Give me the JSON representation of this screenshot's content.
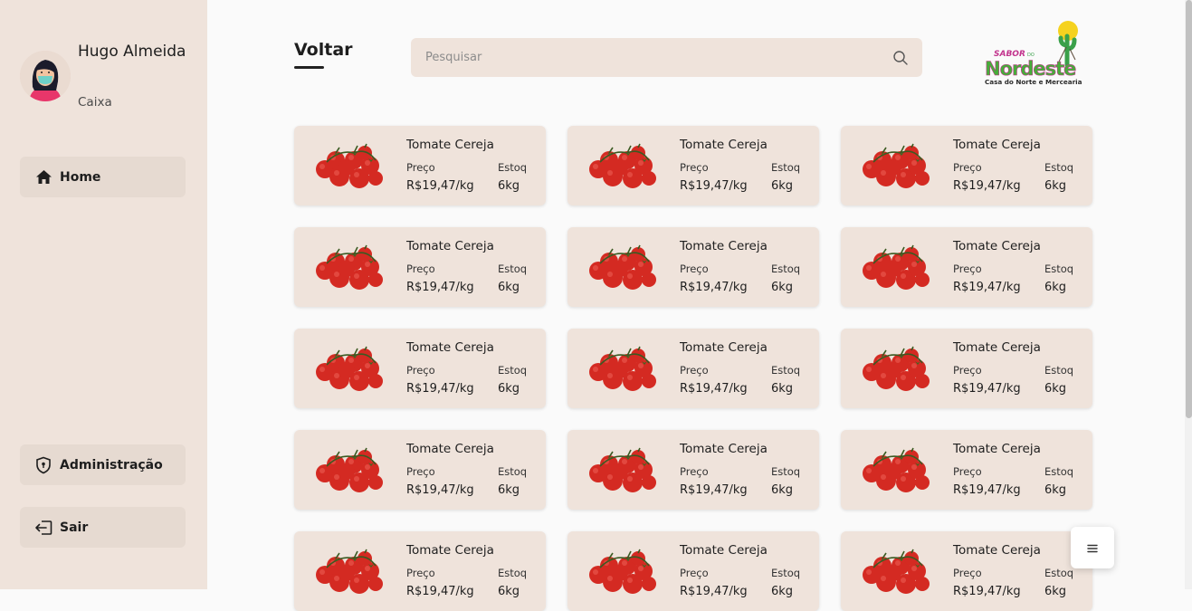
{
  "user": {
    "name": "Hugo Almeida",
    "role": "Caixa"
  },
  "nav": {
    "home": "Home",
    "admin": "Administração",
    "logout": "Sair"
  },
  "header": {
    "back": "Voltar",
    "search_placeholder": "Pesquisar"
  },
  "logo": {
    "line1": "SABOR",
    "line2": "DO",
    "line3": "Nordeste",
    "tagline": "Casa do Norte e Mercearia"
  },
  "labels": {
    "price": "Preço",
    "stock": "Estoq"
  },
  "products": [
    {
      "name": "Tomate Cereja",
      "price": "R$19,47/kg",
      "stock": "6kg"
    },
    {
      "name": "Tomate Cereja",
      "price": "R$19,47/kg",
      "stock": "6kg"
    },
    {
      "name": "Tomate Cereja",
      "price": "R$19,47/kg",
      "stock": "6kg"
    },
    {
      "name": "Tomate Cereja",
      "price": "R$19,47/kg",
      "stock": "6kg"
    },
    {
      "name": "Tomate Cereja",
      "price": "R$19,47/kg",
      "stock": "6kg"
    },
    {
      "name": "Tomate Cereja",
      "price": "R$19,47/kg",
      "stock": "6kg"
    },
    {
      "name": "Tomate Cereja",
      "price": "R$19,47/kg",
      "stock": "6kg"
    },
    {
      "name": "Tomate Cereja",
      "price": "R$19,47/kg",
      "stock": "6kg"
    },
    {
      "name": "Tomate Cereja",
      "price": "R$19,47/kg",
      "stock": "6kg"
    },
    {
      "name": "Tomate Cereja",
      "price": "R$19,47/kg",
      "stock": "6kg"
    },
    {
      "name": "Tomate Cereja",
      "price": "R$19,47/kg",
      "stock": "6kg"
    },
    {
      "name": "Tomate Cereja",
      "price": "R$19,47/kg",
      "stock": "6kg"
    },
    {
      "name": "Tomate Cereja",
      "price": "R$19,47/kg",
      "stock": "6kg"
    },
    {
      "name": "Tomate Cereja",
      "price": "R$19,47/kg",
      "stock": "6kg"
    },
    {
      "name": "Tomate Cereja",
      "price": "R$19,47/kg",
      "stock": "6kg"
    }
  ],
  "icons": {
    "home": "home-icon",
    "admin": "shield-icon",
    "logout": "logout-icon",
    "search": "search-icon",
    "menu": "menu-icon"
  },
  "colors": {
    "sidebar": "#efe3db",
    "button": "#e6dad1",
    "card": "#efe3db",
    "background": "#fafafa",
    "tomato": "#d42a22"
  }
}
